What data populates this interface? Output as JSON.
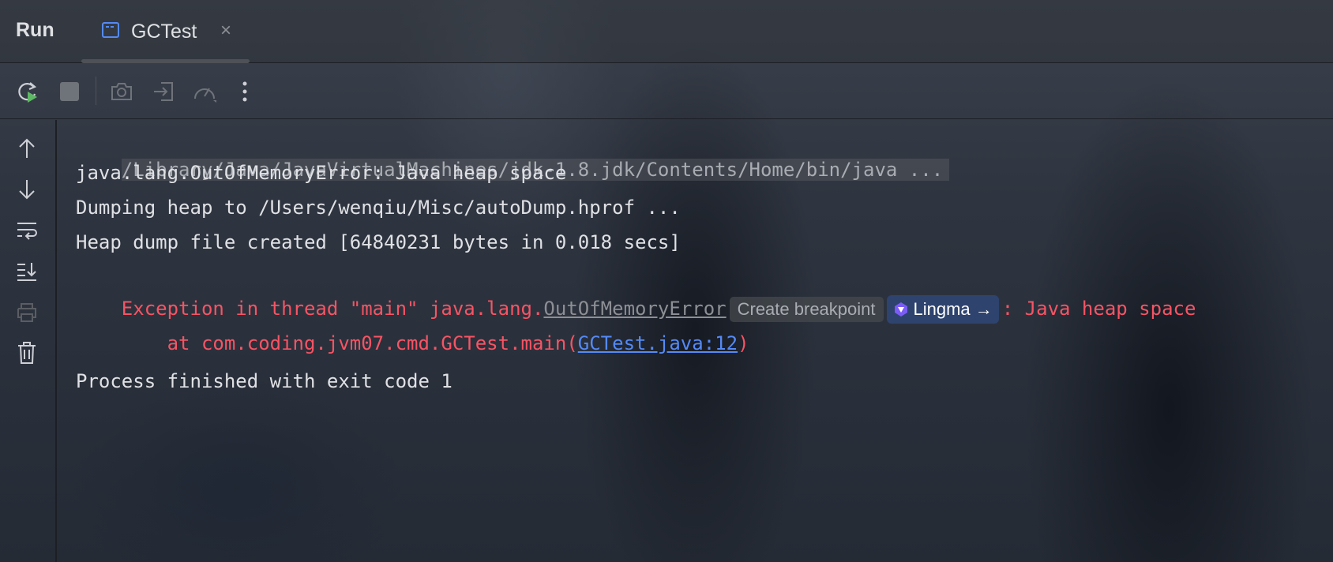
{
  "header": {
    "title": "Run",
    "tab": {
      "label": "GCTest",
      "icon": "console-window-icon",
      "close_icon": "close-icon",
      "close_glyph": "×"
    }
  },
  "toolbar": {
    "buttons": [
      {
        "name": "rerun-icon"
      },
      {
        "name": "stop-icon"
      },
      {
        "name": "camera-icon"
      },
      {
        "name": "import-icon"
      },
      {
        "name": "profiler-icon"
      },
      {
        "name": "more-options-icon"
      }
    ]
  },
  "gutter": {
    "buttons": [
      {
        "name": "scroll-up-icon"
      },
      {
        "name": "scroll-down-icon"
      },
      {
        "name": "soft-wrap-icon"
      },
      {
        "name": "scroll-to-end-icon"
      },
      {
        "name": "print-icon"
      },
      {
        "name": "clear-trash-icon"
      }
    ]
  },
  "console": {
    "command_line": "/Library/Java/JavaVirtualMachines/jdk-1.8.jdk/Contents/Home/bin/java ...",
    "line1": "java.lang.OutOfMemoryError: Java heap space",
    "line2": "Dumping heap to /Users/wenqiu/Misc/autoDump.hprof ...",
    "line3": "Heap dump file created [64840231 bytes in 0.018 secs]",
    "exception": {
      "prefix": "Exception in thread \"main\" java.lang.",
      "class_link": "OutOfMemoryError",
      "breakpoint_chip": "Create breakpoint",
      "lingma_chip": "Lingma →",
      "suffix": ": Java heap space"
    },
    "stack": {
      "prefix": "    at com.coding.jvm07.cmd.GCTest.main(",
      "source_link": "GCTest.java:12",
      "suffix": ")"
    },
    "exit_line": "Process finished with exit code 1"
  },
  "colors": {
    "error": "#f75464",
    "link": "#548af7",
    "text": "#dfe1e5",
    "rerun_green": "#5fb865"
  }
}
